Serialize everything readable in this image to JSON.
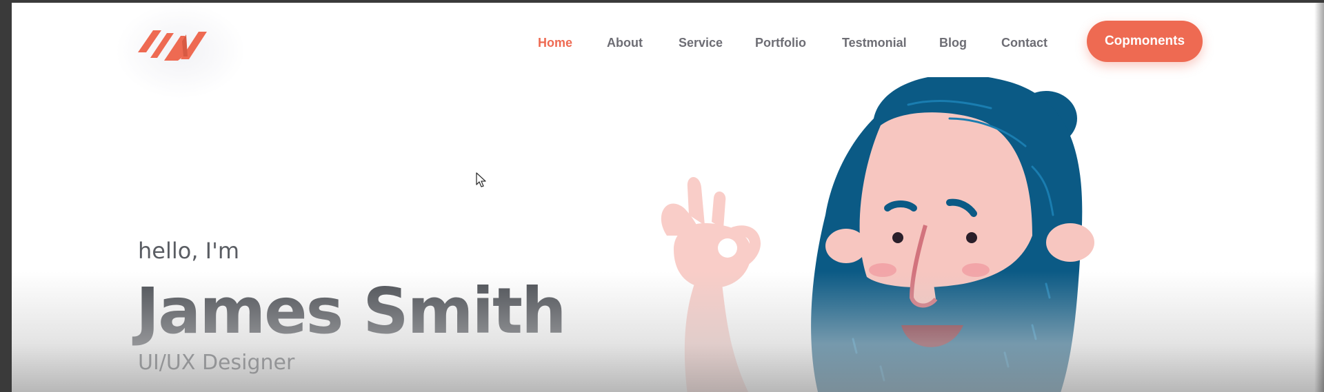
{
  "header": {
    "logo_name": "brand-logo",
    "nav": [
      {
        "label": "Home",
        "active": true
      },
      {
        "label": "About",
        "active": false
      },
      {
        "label": "Service",
        "active": false
      },
      {
        "label": "Portfolio",
        "active": false
      },
      {
        "label": "Testmonial",
        "active": false
      },
      {
        "label": "Blog",
        "active": false
      },
      {
        "label": "Contact",
        "active": false
      }
    ],
    "cta_label": "Copmonents"
  },
  "hero": {
    "greeting": "hello, I'm",
    "name": "James Smith",
    "role": "UI/UX Designer"
  },
  "colors": {
    "accent": "#ee6a52",
    "text_dark": "#4a4d53",
    "nav_text": "#6d6d74",
    "hair": "#0b5a85",
    "skin": "#f7c6c0",
    "hair_tie": "#19c8e6"
  },
  "icons": [
    "brand-logo-icon",
    "cursor-icon"
  ]
}
